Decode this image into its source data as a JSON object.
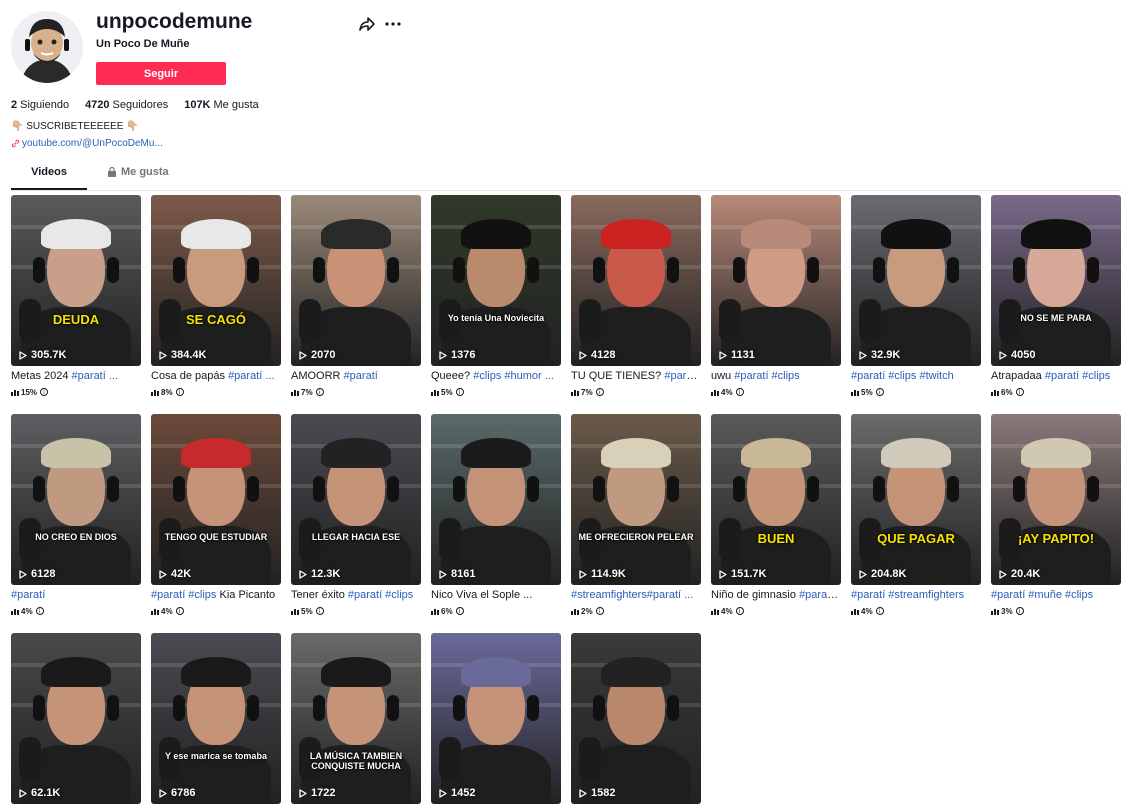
{
  "profile": {
    "username": "unpocodemune",
    "nickname": "Un Poco De Muñe",
    "follow_label": "Seguir",
    "stats": {
      "following_count": "2",
      "following_label": "Siguiendo",
      "followers_count": "4720",
      "followers_label": "Seguidores",
      "likes_count": "107K",
      "likes_label": "Me gusta"
    },
    "bio": "👇🏼 SUSCRIBETEEEEEE 👇🏼",
    "link": "youtube.com/@UnPocoDeMu..."
  },
  "tabs": {
    "videos": "Videos",
    "likes": "Me gusta"
  },
  "colors": {
    "accent": "#fe2c55",
    "link": "#2b5db9",
    "text": "#161823"
  },
  "videos": [
    {
      "views": "305.7K",
      "caption": "Metas 2024 ",
      "tags": "#paratí ...",
      "metric": "15%",
      "overlay": "DEUDA",
      "bg": "#5a5a5a",
      "skin": "#c8a08a",
      "cap": "#e8e8e8"
    },
    {
      "views": "384.4K",
      "caption": "Cosa de papás ",
      "tags": "#paratí ...",
      "metric": "8%",
      "overlay": "SE CAGÓ",
      "bg": "#7d5a4a",
      "skin": "#c99b7e",
      "cap": "#e8e8e8"
    },
    {
      "views": "2070",
      "caption": "AMOORR ",
      "tags": "#paratí",
      "metric": "7%",
      "overlay": "",
      "bg": "#9b8a7a",
      "skin": "#c99277",
      "cap": "#2a2a2a"
    },
    {
      "views": "1376",
      "caption": "Queee? ",
      "tags": "#clips #humor ...",
      "metric": "5%",
      "overlay": "Yo tenía Una Noviecita",
      "bg": "#2f3a2a",
      "skin": "#b98a6c",
      "cap": "#111111"
    },
    {
      "views": "4128",
      "caption": "TU QUE TIENES? ",
      "tags": "#paratí ...",
      "metric": "7%",
      "overlay": "",
      "bg": "#8a6a5e",
      "skin": "#c95a4a",
      "cap": "#cc2222"
    },
    {
      "views": "1131",
      "caption": "uwu ",
      "tags": "#paratí #clips",
      "metric": "4%",
      "overlay": "",
      "bg": "#b88a7a",
      "skin": "#cf9a86",
      "cap": "#b88a7a"
    },
    {
      "views": "32.9K",
      "caption": "",
      "tags": "#paratí #clips #twitch",
      "metric": "5%",
      "overlay": "",
      "bg": "#6a6a72",
      "skin": "#c99b7e",
      "cap": "#111111"
    },
    {
      "views": "4050",
      "caption": "Atrapadaa ",
      "tags": "#paratí #clips",
      "metric": "6%",
      "overlay": "NO SE ME PARA",
      "bg": "#7a6a8a",
      "skin": "#d5a898",
      "cap": "#111111"
    },
    {
      "views": "6128",
      "caption": "",
      "tags": "#paratí",
      "metric": "4%",
      "overlay": "NO CREO EN DIOS",
      "bg": "#5e5e62",
      "skin": "#c09a80",
      "cap": "#c7c2a8"
    },
    {
      "views": "42K",
      "caption": "",
      "tags": "#paratí #clips",
      "tail": " Kia Picanto",
      "metric": "4%",
      "overlay": "TENGO QUE ESTUDIAR",
      "bg": "#6a4a3a",
      "skin": "#c59478",
      "cap": "#c72a2a"
    },
    {
      "views": "12.3K",
      "caption": "Tener éxito ",
      "tags": "#paratí #clips",
      "metric": "5%",
      "overlay": "LLEGAR HACIA ESE",
      "bg": "#4a4a52",
      "skin": "#c59478",
      "cap": "#222222"
    },
    {
      "views": "8161",
      "caption": "Nico Viva el Sople ...",
      "tags": "",
      "metric": "6%",
      "overlay": "",
      "bg": "#5a6a6a",
      "skin": "#c59478",
      "cap": "#1a1a1a"
    },
    {
      "views": "114.9K",
      "caption": "",
      "tags": "#streamfighters#paratí ...",
      "metric": "2%",
      "overlay": "ME OFRECIERON PELEAR",
      "bg": "#6a5a4a",
      "skin": "#c09a80",
      "cap": "#d8d0b8"
    },
    {
      "views": "151.7K",
      "caption": "Niño de gimnasio ",
      "tags": "#paratí...",
      "metric": "4%",
      "overlay": "BUEN",
      "bg": "#5a5a5a",
      "skin": "#c59478",
      "cap": "#c8b896"
    },
    {
      "views": "204.8K",
      "caption": "",
      "tags": "#paratí #streamfighters",
      "metric": "4%",
      "overlay": "QUE PAGAR",
      "bg": "#6a6a6a",
      "skin": "#c59478",
      "cap": "#cfcaba"
    },
    {
      "views": "20.4K",
      "caption": "",
      "tags": "#paratí #muñe #clips",
      "metric": "3%",
      "overlay": "¡AY PAPITO!",
      "bg": "#8a7a7a",
      "skin": "#c59478",
      "cap": "#d0c8b0"
    },
    {
      "views": "62.1K",
      "caption": "",
      "tags": "",
      "metric": "",
      "overlay": "",
      "bg": "#4a4a4a",
      "skin": "#c59478",
      "cap": "#1a1a1a"
    },
    {
      "views": "6786",
      "caption": "",
      "tags": "",
      "metric": "",
      "overlay": "Y ese marica se tomaba",
      "bg": "#4a4a52",
      "skin": "#c59478",
      "cap": "#1a1a1a"
    },
    {
      "views": "1722",
      "caption": "",
      "tags": "",
      "metric": "",
      "overlay": "LA MÚSICA TAMBIEN CONQUISTE MUCHA",
      "bg": "#6a6a6a",
      "skin": "#c59478",
      "cap": "#1a1a1a"
    },
    {
      "views": "1452",
      "caption": "",
      "tags": "",
      "metric": "",
      "overlay": "",
      "bg": "#6a6a9a",
      "skin": "#c59478",
      "cap": "#6a6a9a"
    },
    {
      "views": "1582",
      "caption": "",
      "tags": "",
      "metric": "",
      "overlay": "",
      "bg": "#3a3a3a",
      "skin": "#b9876c",
      "cap": "#222222"
    }
  ]
}
